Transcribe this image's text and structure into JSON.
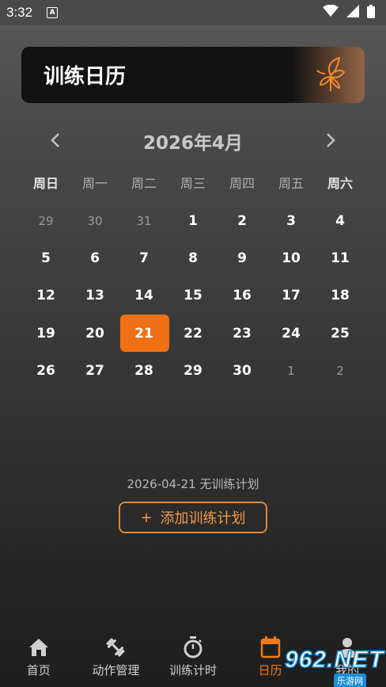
{
  "status_bar": {
    "time": "3:32",
    "notification_icon": "a-icon",
    "icons": [
      "wifi-icon",
      "signal-icon",
      "battery-icon"
    ]
  },
  "header": {
    "title": "训练日历",
    "logo_icon": "butterfly-icon"
  },
  "calendar": {
    "month_title": "2026年4月",
    "weekdays": [
      "周日",
      "周一",
      "周二",
      "周三",
      "周四",
      "周五",
      "周六"
    ],
    "weeks": [
      [
        "29",
        "30",
        "31",
        "1",
        "2",
        "3",
        "4"
      ],
      [
        "5",
        "6",
        "7",
        "8",
        "9",
        "10",
        "11"
      ],
      [
        "12",
        "13",
        "14",
        "15",
        "16",
        "17",
        "18"
      ],
      [
        "19",
        "20",
        "21",
        "22",
        "23",
        "24",
        "25"
      ],
      [
        "26",
        "27",
        "28",
        "29",
        "30",
        "1",
        "2"
      ]
    ],
    "selected_day": "21",
    "accent_color": "#f07013"
  },
  "plan": {
    "status_text": "2026-04-21 无训练计划",
    "add_button_label": "添加训练计划",
    "add_icon": "+"
  },
  "bottom_nav": {
    "items": [
      {
        "label": "首页",
        "icon": "home-icon"
      },
      {
        "label": "动作管理",
        "icon": "dumbbell-icon"
      },
      {
        "label": "训练计时",
        "icon": "stopwatch-icon"
      },
      {
        "label": "日历",
        "icon": "calendar-icon"
      },
      {
        "label": "我的",
        "icon": "person-icon"
      }
    ],
    "active": "日历"
  },
  "watermark": {
    "number": "962.NET",
    "subtitle": "乐游网"
  }
}
